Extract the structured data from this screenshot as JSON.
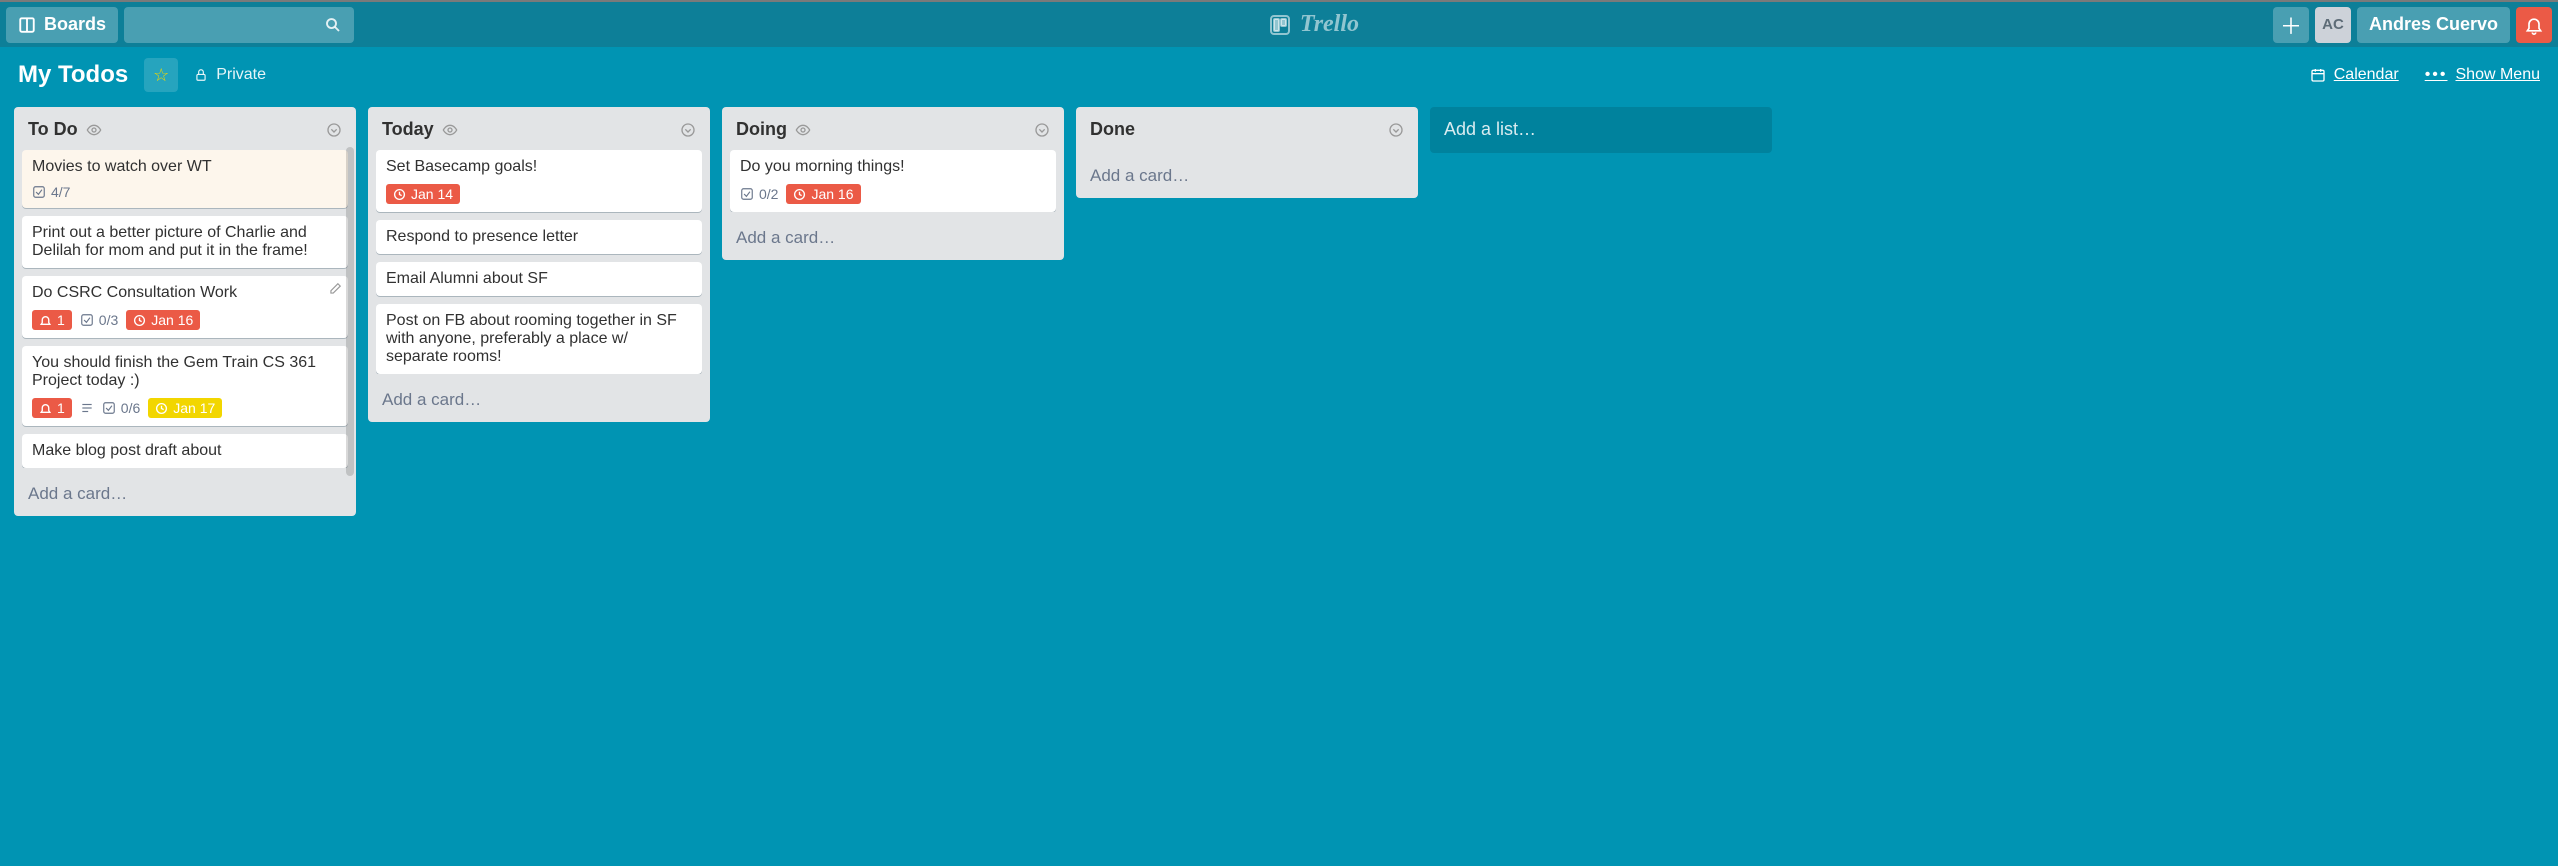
{
  "header": {
    "boards_label": "Boards",
    "logo_text": "Trello",
    "user_initials": "AC",
    "user_name": "Andres Cuervo"
  },
  "board": {
    "title": "My Todos",
    "visibility": "Private",
    "calendar_label": "Calendar",
    "show_menu_label": "Show Menu"
  },
  "lists": [
    {
      "name": "To Do",
      "watched": true,
      "add_card_label": "Add a card…",
      "cards": [
        {
          "title": "Movies to watch over WT",
          "cover": true,
          "checklist": "4/7"
        },
        {
          "title": "Print out a better picture of Charlie and Delilah for mom and put it in the frame!"
        },
        {
          "title": "Do CSRC Consultation Work",
          "pencil": true,
          "notif": "1",
          "checklist": "0/3",
          "due": "Jan 16",
          "due_color": "red"
        },
        {
          "title": "You should finish the Gem Train CS 361 Project today :)",
          "notif": "1",
          "desc": true,
          "checklist": "0/6",
          "due": "Jan 17",
          "due_color": "yellow"
        },
        {
          "title": "Make blog post draft about"
        }
      ]
    },
    {
      "name": "Today",
      "watched": true,
      "add_card_label": "Add a card…",
      "cards": [
        {
          "title": "Set Basecamp goals!",
          "due": "Jan 14",
          "due_color": "red"
        },
        {
          "title": "Respond to presence letter"
        },
        {
          "title": "Email Alumni about SF"
        },
        {
          "title": "Post on FB about rooming together in SF with anyone, preferably a place w/ separate rooms!"
        }
      ]
    },
    {
      "name": "Doing",
      "watched": true,
      "add_card_label": "Add a card…",
      "cards": [
        {
          "title": "Do you morning things!",
          "checklist": "0/2",
          "due": "Jan 16",
          "due_color": "red"
        }
      ]
    },
    {
      "name": "Done",
      "watched": false,
      "add_card_label": "Add a card…",
      "cards": []
    }
  ],
  "add_list_label": "Add a list…"
}
